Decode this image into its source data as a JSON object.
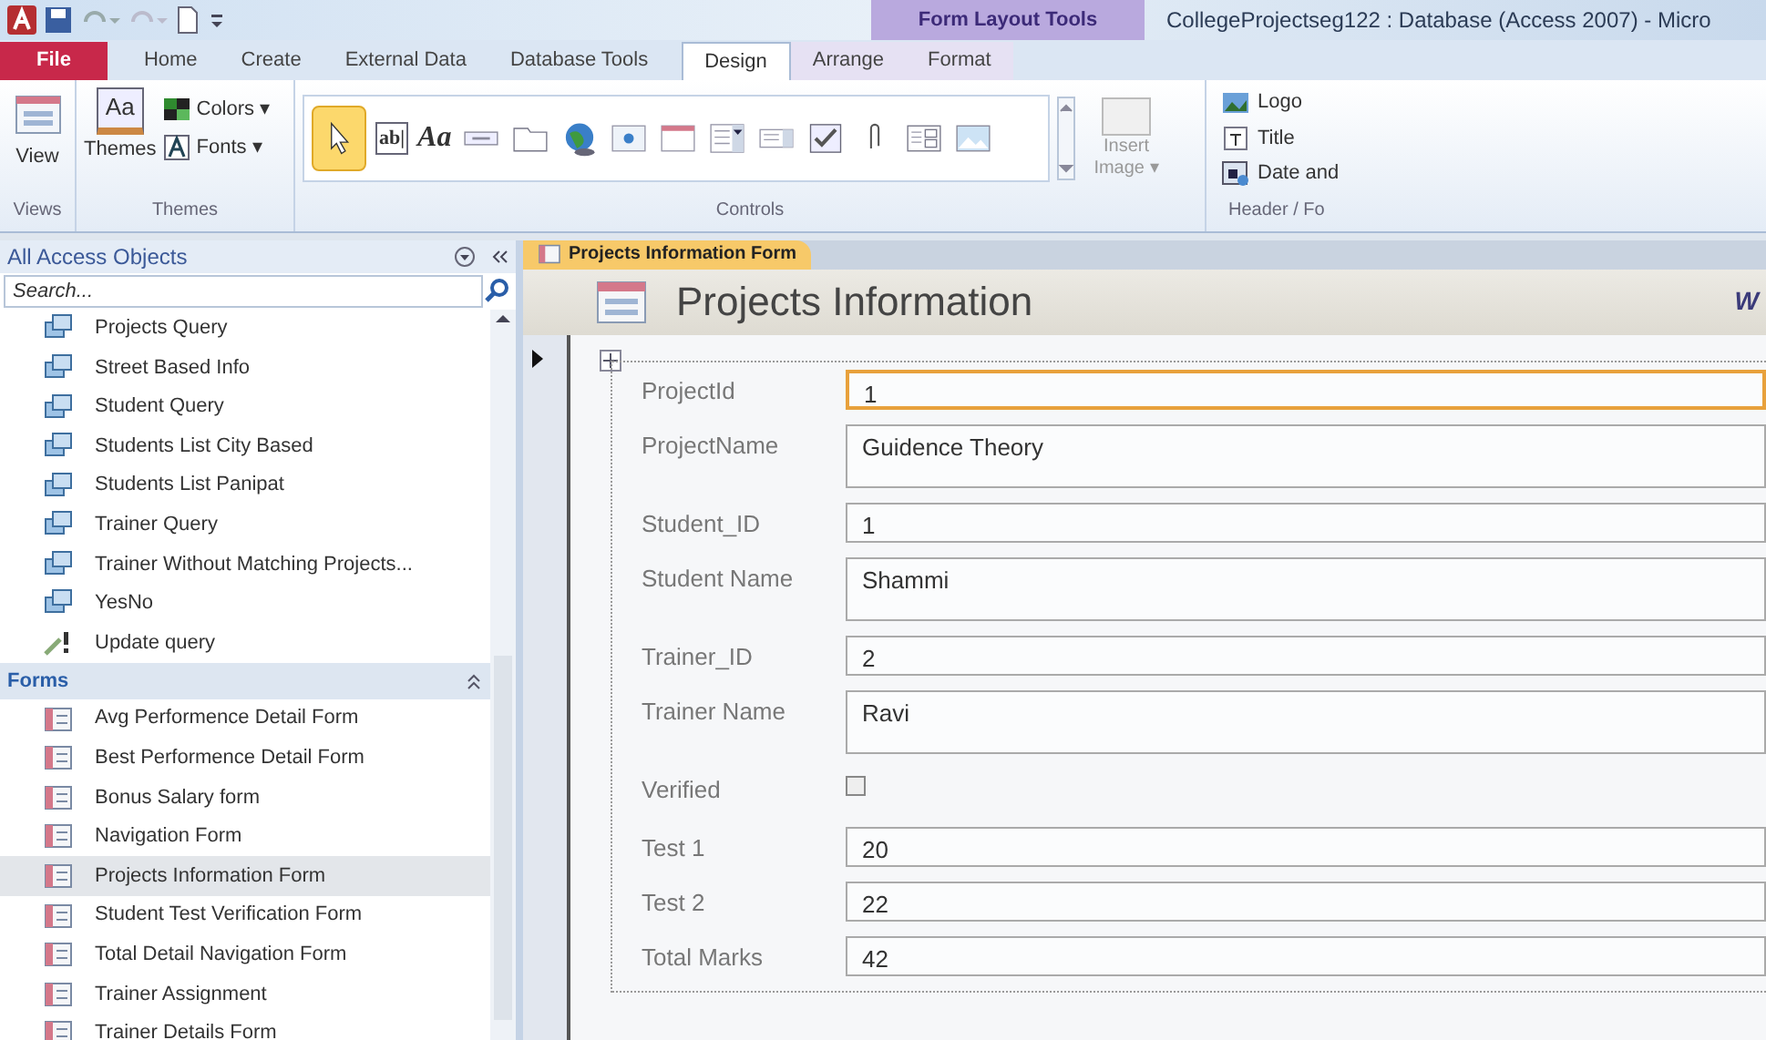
{
  "window": {
    "title": "CollegeProjectseg122 : Database (Access 2007) - Micro",
    "context_tab_group": "Form Layout Tools"
  },
  "ribbon_tabs": [
    {
      "label": "File",
      "kind": "file",
      "selected": false
    },
    {
      "label": "Home",
      "kind": "normal",
      "selected": false
    },
    {
      "label": "Create",
      "kind": "normal",
      "selected": false
    },
    {
      "label": "External Data",
      "kind": "normal",
      "selected": false
    },
    {
      "label": "Database Tools",
      "kind": "normal",
      "selected": false
    },
    {
      "label": "Design",
      "kind": "context",
      "selected": true
    },
    {
      "label": "Arrange",
      "kind": "context",
      "selected": false
    },
    {
      "label": "Format",
      "kind": "context",
      "selected": false
    }
  ],
  "ribbon": {
    "views": {
      "button": "View",
      "group": "Views"
    },
    "themes": {
      "icon_glyph": "Aa",
      "themes_button": "Themes",
      "colors_button": "Colors ▾",
      "fonts_button": "Fonts ▾",
      "group": "Themes"
    },
    "controls": {
      "group": "Controls",
      "items": [
        {
          "kind": "pointer",
          "selected": true
        },
        {
          "kind": "textbox",
          "glyph": "ab|",
          "selected": false
        },
        {
          "kind": "label",
          "glyph": "Aa",
          "selected": false
        },
        {
          "kind": "button",
          "selected": false
        },
        {
          "kind": "tab",
          "selected": false
        },
        {
          "kind": "hyperlink",
          "selected": false
        },
        {
          "kind": "webbrowser",
          "selected": false
        },
        {
          "kind": "navigation",
          "selected": false
        },
        {
          "kind": "combobox",
          "selected": false
        },
        {
          "kind": "listbox",
          "selected": false
        },
        {
          "kind": "checkbox",
          "selected": false
        },
        {
          "kind": "attachment",
          "selected": false
        },
        {
          "kind": "subform",
          "selected": false
        },
        {
          "kind": "image",
          "selected": false
        }
      ]
    },
    "insert_image": "Insert Image ▾",
    "header_footer": {
      "group": "Header / Fo",
      "items": [
        {
          "kind": "logo",
          "label": "Logo"
        },
        {
          "kind": "title",
          "label": "Title"
        },
        {
          "kind": "date",
          "label": "Date and"
        }
      ]
    }
  },
  "nav_pane": {
    "title": "All Access Objects",
    "search_placeholder": "Search...",
    "items": [
      {
        "kind": "query",
        "label": "Projects Query",
        "selected": false
      },
      {
        "kind": "query",
        "label": "Street Based Info",
        "selected": false
      },
      {
        "kind": "query",
        "label": "Student Query",
        "selected": false
      },
      {
        "kind": "query",
        "label": "Students List City Based",
        "selected": false
      },
      {
        "kind": "query",
        "label": "Students List Panipat",
        "selected": false
      },
      {
        "kind": "query",
        "label": "Trainer Query",
        "selected": false
      },
      {
        "kind": "query",
        "label": "Trainer Without Matching Projects...",
        "selected": false
      },
      {
        "kind": "query",
        "label": "YesNo",
        "selected": false
      },
      {
        "kind": "update",
        "label": "Update query",
        "selected": false
      },
      {
        "kind": "group",
        "label": "Forms",
        "expanded": true
      },
      {
        "kind": "form",
        "label": "Avg Performence Detail Form",
        "selected": false
      },
      {
        "kind": "form",
        "label": "Best Performence Detail Form",
        "selected": false
      },
      {
        "kind": "form",
        "label": "Bonus Salary form",
        "selected": false
      },
      {
        "kind": "form",
        "label": "Navigation Form",
        "selected": false
      },
      {
        "kind": "form",
        "label": "Projects Information Form",
        "selected": true
      },
      {
        "kind": "form",
        "label": "Student Test Verification Form",
        "selected": false
      },
      {
        "kind": "form",
        "label": "Total Detail Navigation Form",
        "selected": false
      },
      {
        "kind": "form",
        "label": "Trainer Assignment",
        "selected": false
      },
      {
        "kind": "form",
        "label": "Trainer Details Form",
        "selected": false
      }
    ]
  },
  "document_tab": {
    "label": "Projects Information Form",
    "selected": true
  },
  "form": {
    "title": "Projects Information",
    "header_cut_text": "W",
    "fields": [
      {
        "kind": "text",
        "label": "ProjectId",
        "value": "1",
        "focused": true
      },
      {
        "kind": "multiline",
        "label": "ProjectName",
        "value": "Guidence Theory",
        "focused": false
      },
      {
        "kind": "text",
        "label": "Student_ID",
        "value": "1",
        "focused": false
      },
      {
        "kind": "multiline",
        "label": "Student Name",
        "value": "Shammi",
        "focused": false
      },
      {
        "kind": "text",
        "label": "Trainer_ID",
        "value": "2",
        "focused": false
      },
      {
        "kind": "multiline",
        "label": "Trainer Name",
        "value": "Ravi",
        "focused": false
      },
      {
        "kind": "checkbox",
        "label": "Verified",
        "checked": false
      },
      {
        "kind": "text",
        "label": "Test 1",
        "value": "20",
        "focused": false
      },
      {
        "kind": "text",
        "label": "Test 2",
        "value": "22",
        "focused": false
      },
      {
        "kind": "text",
        "label": "Total Marks",
        "value": "42",
        "focused": false
      }
    ]
  }
}
